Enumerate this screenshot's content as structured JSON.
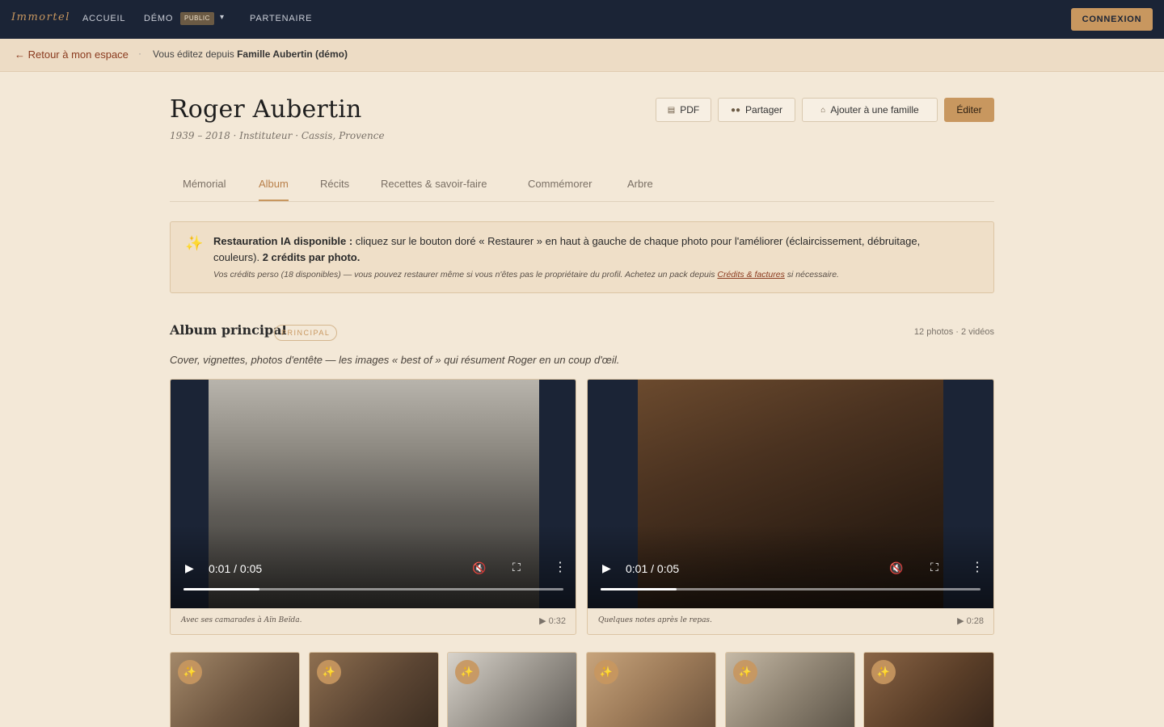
{
  "nav": {
    "brand": "Immortel",
    "accueil": "ACCUEIL",
    "demo": "DÉMO",
    "demo_badge": "PUBLIC",
    "caret": "▾",
    "partenaire": "PARTENAIRE",
    "login": "CONNEXION"
  },
  "editbar": {
    "back": "← Retour à mon espace",
    "dot": "·",
    "text_prefix": "Vous éditez depuis ",
    "text_family": "Famille Aubertin (démo)"
  },
  "person": {
    "name": "Roger Aubertin",
    "meta": "1939 – 2018 · Instituteur · Cassis, Provence"
  },
  "actions": {
    "pdf": "PDF",
    "share": "Partager",
    "add_family": "Ajouter à une famille",
    "edit": "Éditer"
  },
  "tabs": [
    {
      "label": "Mémorial"
    },
    {
      "label": "Album"
    },
    {
      "label": "Récits"
    },
    {
      "label": "Recettes & savoir-faire"
    },
    {
      "label": "Commémorer"
    },
    {
      "label": "Arbre"
    }
  ],
  "notice": {
    "icon": "✨",
    "bold1": "Restauration IA disponible :",
    "text1": " cliquez sur le bouton doré « Restaurer » en haut à gauche de chaque photo pour l'améliorer (éclaircissement, débruitage, couleurs). ",
    "bold2": "2 crédits par photo.",
    "sub_text1": "Vos crédits perso (18 disponibles) — vous pouvez restaurer même si vous n'êtes pas le propriétaire du profil. Achetez un pack depuis ",
    "sub_link": "Crédits & factures",
    "sub_text2": " si nécessaire."
  },
  "album": {
    "title": "Album principal",
    "badge": "PRINCIPAL",
    "count": "12 photos · 2 vidéos",
    "description": "Cover, vignettes, photos d'entête — les images « best of » qui résument Roger en un coup d'œil."
  },
  "videos": [
    {
      "time": "0:01 / 0:05",
      "progress": 0.2,
      "caption": "Avec ses camarades à Aïn Beïda.",
      "duration": "▶ 0:32"
    },
    {
      "time": "0:01 / 0:05",
      "progress": 0.2,
      "caption": "Quelques notes après le repas.",
      "duration": "▶ 0:28"
    }
  ],
  "player_icons": {
    "play": "▶",
    "mute": "🔇",
    "fullscreen": "⛶",
    "more": "⋮"
  },
  "restore_icon": "✨",
  "colors": {
    "nav_bg": "#1b2436",
    "accent": "#c8975f",
    "page_bg": "#f3e8d7",
    "link": "#8a3a1e"
  }
}
